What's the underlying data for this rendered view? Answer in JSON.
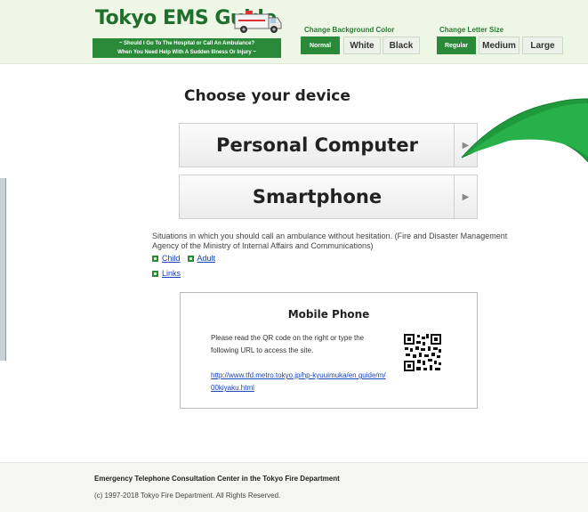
{
  "header": {
    "title": "Tokyo EMS Guide",
    "tagline_1": "~ Should I Go To The Hospital or Call An Ambulance?",
    "tagline_2": "When You Need Help With A Sudden Illness Or Injury ~",
    "bg_label": "Change Background Color",
    "bg_options": [
      "Normal",
      "White",
      "Black"
    ],
    "size_label": "Change Letter Size",
    "size_options": [
      "Regular",
      "Medium",
      "Large"
    ]
  },
  "main": {
    "heading": "Choose your device",
    "devices": [
      "Personal Computer",
      "Smartphone"
    ],
    "situations_text": "Situations in which you should call an ambulance without hesitation. (Fire and Disaster Management Agency of the Ministry of Internal Affairs and Communications)",
    "links": {
      "child": "Child",
      "adult": "Adult",
      "links": "Links"
    }
  },
  "mobile": {
    "title": "Mobile Phone",
    "description": "Please read the QR code on the right or type the following URL to access the site.",
    "url": "http://www.tfd.metro.tokyo.jp/hp-kyuuimuka/en guide/m/00kiyaku.html"
  },
  "footer": {
    "line1": "Emergency Telephone Consultation Center in the Tokyo Fire Department",
    "line2": "(c) 1997-2018 Tokyo Fire Department. All Rights Reserved."
  },
  "colors": {
    "brand_green": "#2a8a3a",
    "header_bg": "#eef6e6",
    "callout_green": "#1e9a3c"
  }
}
